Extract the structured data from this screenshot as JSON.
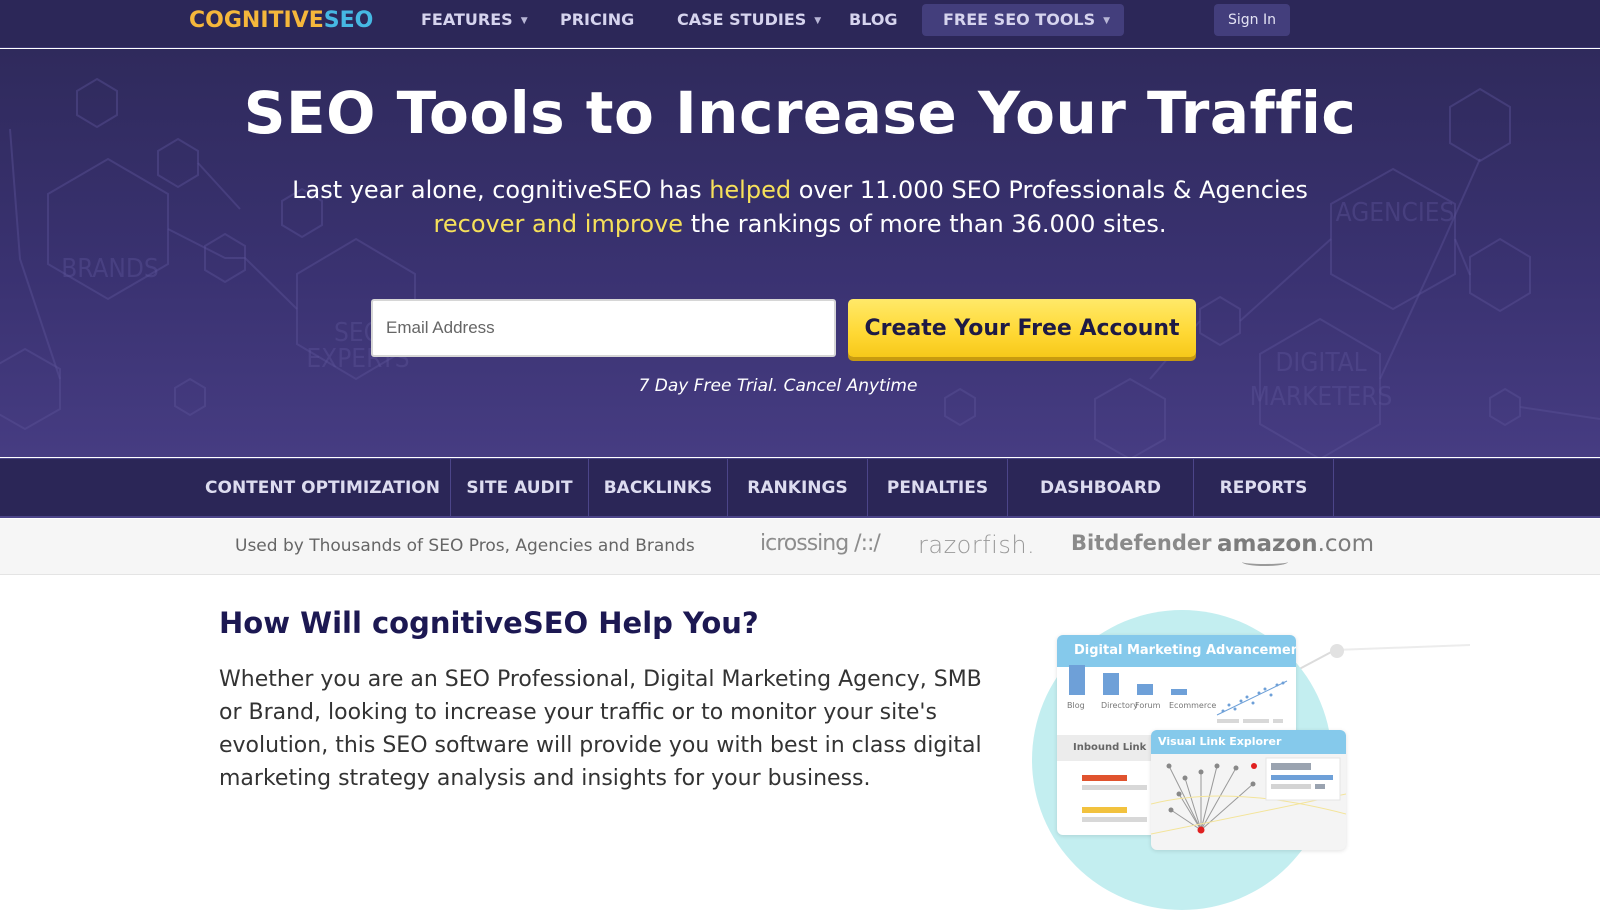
{
  "nav": {
    "logo_part1": "COGNITIVE",
    "logo_part2": "SEO",
    "items": [
      {
        "label": "FEATURES",
        "has_dropdown": true
      },
      {
        "label": "PRICING",
        "has_dropdown": false
      },
      {
        "label": "CASE STUDIES",
        "has_dropdown": true
      },
      {
        "label": "BLOG",
        "has_dropdown": false
      },
      {
        "label": "FREE SEO TOOLS",
        "has_dropdown": true
      }
    ],
    "caret": "▼",
    "signin_label": "Sign In"
  },
  "hero": {
    "title": "SEO Tools to Increase Your Traffic",
    "sub_line1_a": "Last year alone, cognitiveSEO has ",
    "sub_line1_hl": "helped",
    "sub_line1_b": " over 11.000 SEO Professionals & Agencies",
    "sub_line2_hl": "recover and improve",
    "sub_line2_b": " the rankings of more than 36.000 sites.",
    "email_placeholder": "Email Address",
    "email_value": "",
    "cta_label": "Create Your Free Account",
    "trial_note": "7 Day Free Trial. Cancel Anytime",
    "bg_words": [
      "BRANDS",
      "SEO EXPERTS",
      "AGENCIES",
      "DIGITAL MARKETERS"
    ],
    "highlight_color": "#f6e05a",
    "cta_color": "#ffd833"
  },
  "feature_tabs": [
    "CONTENT OPTIMIZATION",
    "SITE AUDIT",
    "BACKLINKS",
    "RANKINGS",
    "PENALTIES",
    "DASHBOARD",
    "REPORTS"
  ],
  "trust": {
    "text": "Used by Thousands of SEO Pros, Agencies and Brands",
    "brands": [
      "icrossing /::/",
      "razorfish.",
      "Bitdefender",
      "amazon",
      ".com"
    ]
  },
  "content": {
    "title": "How Will cognitiveSEO Help You?",
    "body": "Whether you are an SEO Professional, Digital Marketing Agency, SMB or Brand, looking to increase your traffic or to monitor your site's evolution, this SEO software will provide you with best in class digital marketing strategy analysis and insights for your business."
  },
  "illustration": {
    "card1_title": "Digital Marketing Advancement",
    "bar_labels": [
      "Blog",
      "Directory",
      "Forum",
      "Ecommerce"
    ],
    "bar_values": [
      1.0,
      0.72,
      0.36,
      0.2
    ],
    "inbound_label": "Inbound Link",
    "card2_title": "Visual Link Explorer"
  }
}
